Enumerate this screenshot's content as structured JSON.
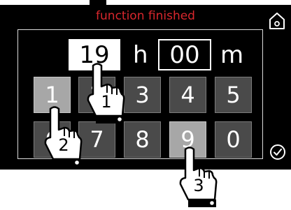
{
  "screen": {
    "title": "function finished",
    "title_color": "#d8272d"
  },
  "time": {
    "hours": "19",
    "hours_unit": "h",
    "minutes": "00",
    "minutes_unit": "m"
  },
  "keypad": {
    "row1": [
      "1",
      "2",
      "3",
      "4",
      "5"
    ],
    "row2": [
      "6",
      "7",
      "8",
      "9",
      "0"
    ],
    "selected": [
      "1",
      "9"
    ]
  },
  "steps": [
    "1",
    "2",
    "3"
  ],
  "icons": {
    "home": "home-icon",
    "confirm": "checkmark-icon",
    "pointer": "pointing-hand-icon"
  }
}
